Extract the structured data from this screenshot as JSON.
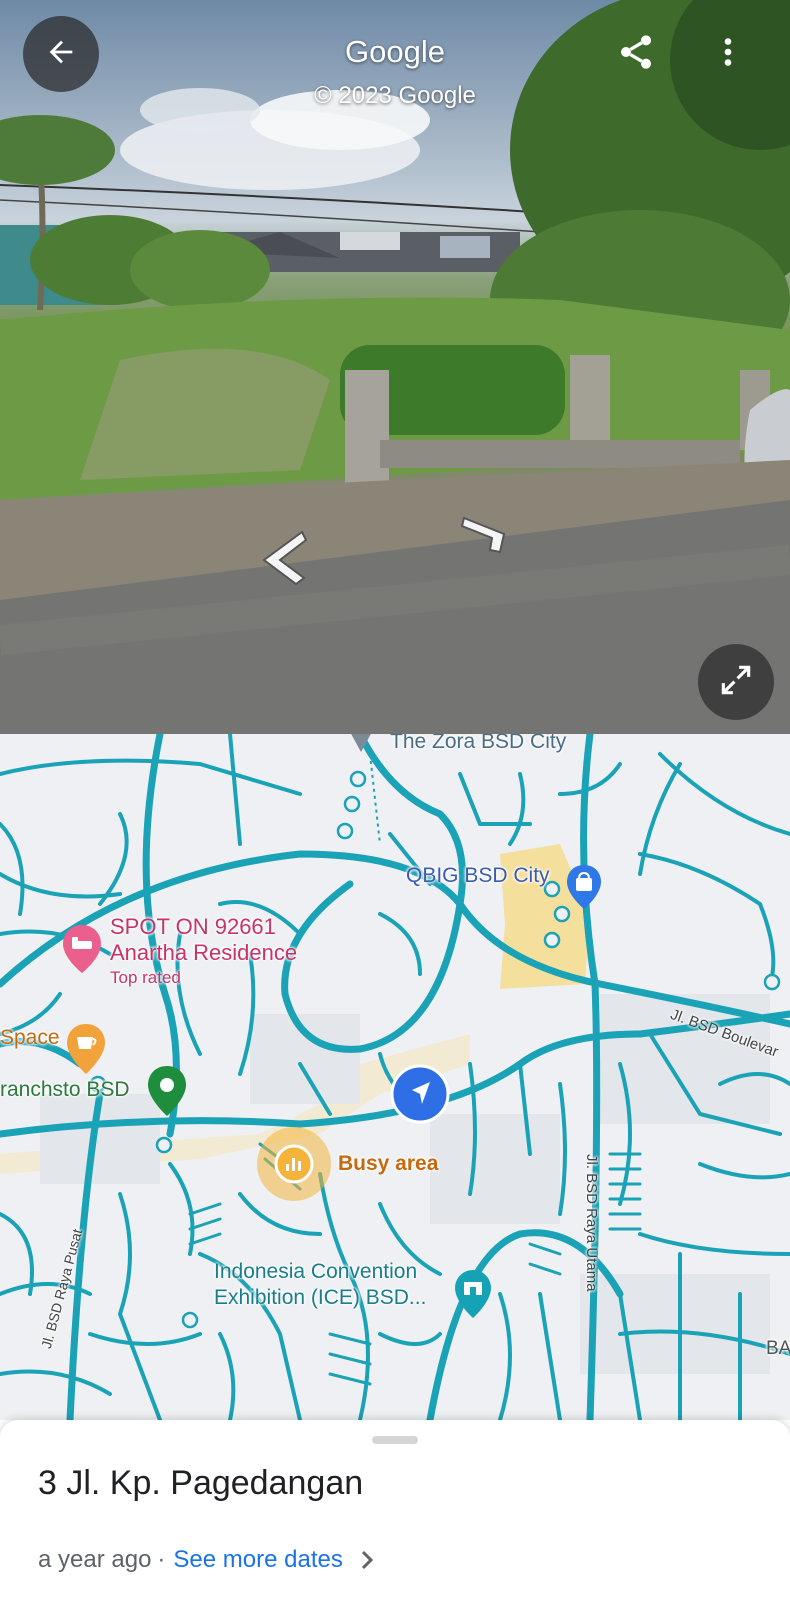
{
  "streetview": {
    "title": "Google",
    "copyright": "© 2023 Google",
    "icons": {
      "back": "arrow-left-icon",
      "share": "share-icon",
      "more": "more-vert-icon",
      "expand": "expand-icon",
      "nav_left": "chevron-left-icon",
      "nav_right": "chevron-right-icon"
    }
  },
  "map": {
    "places": {
      "zora": "The Zora BSD City",
      "qbig": "QBIG BSD City",
      "spot_name_1": "SPOT ON 92661",
      "spot_name_2": "Anartha Residence",
      "spot_badge": "Top rated",
      "space": "Space",
      "branchsto": "ranchsto BSD",
      "busy": "Busy area",
      "ice_1": "Indonesia Convention",
      "ice_2": "Exhibition (ICE) BSD...",
      "ba": "BA"
    },
    "roads": {
      "boulevard": "Jl. BSD Boulevar",
      "raya_utama": "Jl. BSD Raya Utama",
      "raya_pusat": "Jl. BSD Raya Pusat"
    },
    "colors": {
      "road": "#1aa2b6",
      "shopping_area": "#f6dc8c",
      "hotel_pin": "#ea5f8c",
      "cafe_pin": "#f2a23a",
      "store_pin": "#1e8e3e",
      "location_marker": "#2f6fe6",
      "busy_area": "#f4b43a",
      "shopping_pin": "#2f78e8",
      "ice_pin": "#15a2b5"
    }
  },
  "sheet": {
    "address": "3 Jl. Kp. Pagedangan",
    "date": "a year ago",
    "separator": "·",
    "more_dates": "See more dates"
  }
}
